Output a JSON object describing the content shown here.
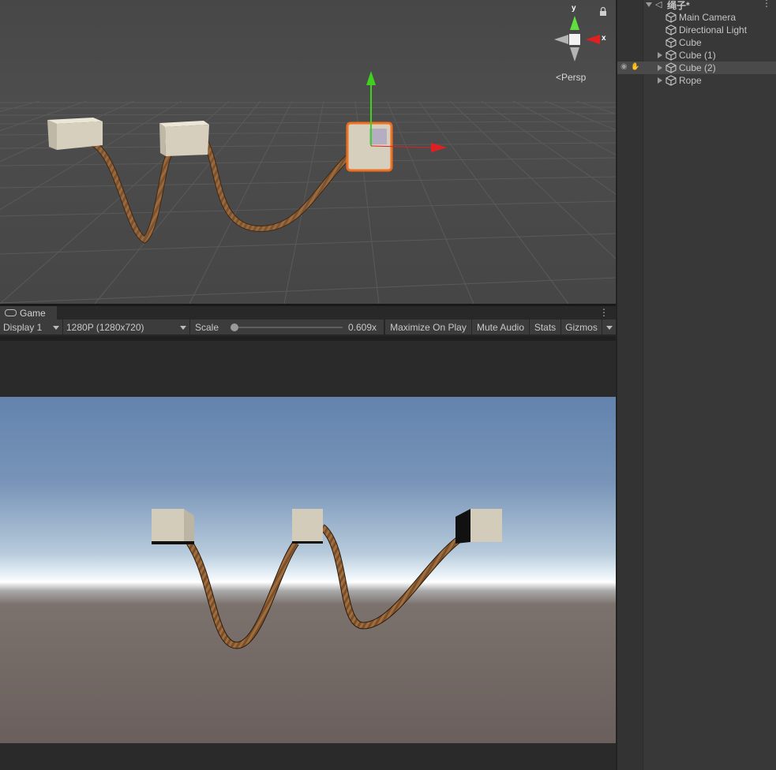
{
  "scene_view": {
    "projection_label": "<Persp",
    "gizmo": {
      "x_label": "x",
      "y_label": "y"
    }
  },
  "game_panel": {
    "tab_label": "Game",
    "toolbar": {
      "display": "Display 1",
      "resolution": "1280P (1280x720)",
      "scale_label": "Scale",
      "scale_value": "0.609x",
      "scale_fraction": 0.05,
      "maximize_on_play": "Maximize On Play",
      "mute_audio": "Mute Audio",
      "stats": "Stats",
      "gizmos": "Gizmos"
    }
  },
  "hierarchy": {
    "scene_name": "绳子*",
    "items": [
      {
        "label": "Main Camera",
        "expandable": false,
        "selected": false
      },
      {
        "label": "Directional Light",
        "expandable": false,
        "selected": false
      },
      {
        "label": "Cube",
        "expandable": false,
        "selected": false
      },
      {
        "label": "Cube (1)",
        "expandable": true,
        "selected": false
      },
      {
        "label": "Cube (2)",
        "expandable": true,
        "selected": true
      },
      {
        "label": "Rope",
        "expandable": true,
        "selected": false
      }
    ]
  },
  "colors": {
    "editor_bg": "#282828",
    "toolbar_bg": "#3c3c3c",
    "scene_bg": "#474747",
    "selection_outline": "#f07020",
    "rope": "#8a5a2e",
    "cube": "#d6cfbd",
    "x_axis": "#e02020",
    "y_axis": "#40d020",
    "sky_top": "#5f7fab",
    "horizon": "#ffffff",
    "ground": "#6a5f5c"
  }
}
